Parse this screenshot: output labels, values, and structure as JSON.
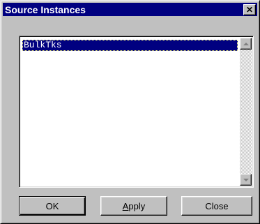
{
  "window": {
    "title": "Source Instances",
    "close_glyph": "✕"
  },
  "list": {
    "items": [
      {
        "label": "BulkTks",
        "selected": true
      }
    ]
  },
  "buttons": {
    "ok_label": "OK",
    "apply_mnemonic": "A",
    "apply_rest": "pply",
    "close_label": "Close"
  },
  "colors": {
    "titlebar": "#000080",
    "face": "#c0c0c0",
    "selection": "#000080"
  }
}
